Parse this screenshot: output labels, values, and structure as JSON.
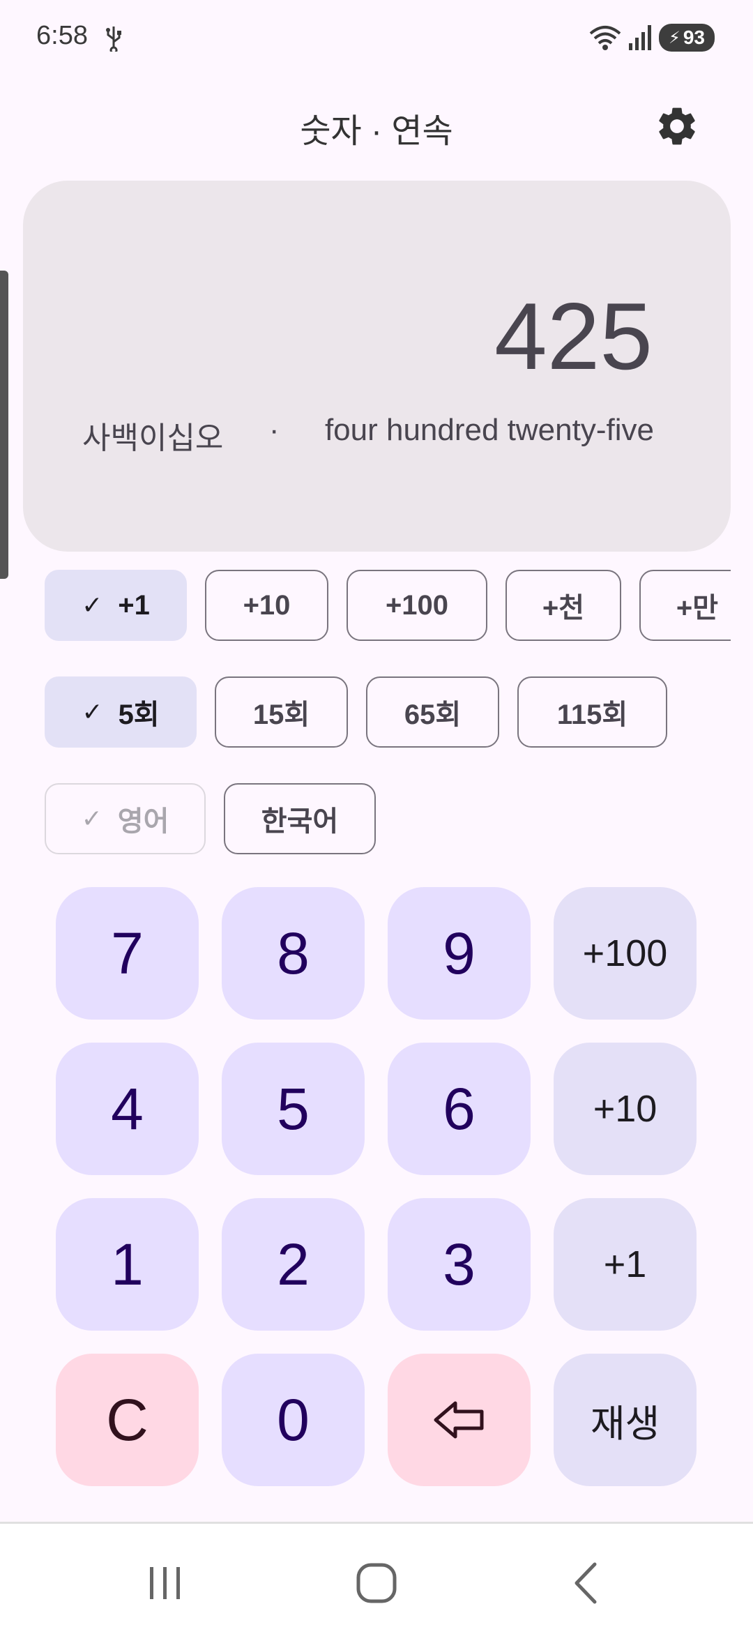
{
  "status_bar": {
    "time": "6:58",
    "battery": "93",
    "icons": [
      "usb-icon",
      "wifi-icon",
      "signal-icon",
      "battery-icon"
    ]
  },
  "header": {
    "title": "숫자 · 연속",
    "settings_icon": "gear-icon"
  },
  "display": {
    "number": "425",
    "korean": "사백이십오",
    "separator": "·",
    "english": "four hundred twenty-five"
  },
  "step_chips": [
    {
      "label": "+1",
      "selected": true
    },
    {
      "label": "+10",
      "selected": false
    },
    {
      "label": "+100",
      "selected": false
    },
    {
      "label": "+천",
      "selected": false
    },
    {
      "label": "+만",
      "selected": false
    }
  ],
  "count_chips": [
    {
      "label": "5회",
      "selected": true
    },
    {
      "label": "15회",
      "selected": false
    },
    {
      "label": "65회",
      "selected": false
    },
    {
      "label": "115회",
      "selected": false
    }
  ],
  "language_chips": [
    {
      "label": "영어",
      "selected": true,
      "disabled": true
    },
    {
      "label": "한국어",
      "selected": false
    }
  ],
  "keypad": {
    "k7": "7",
    "k8": "8",
    "k9": "9",
    "plus100": "+100",
    "k4": "4",
    "k5": "5",
    "k6": "6",
    "plus10": "+10",
    "k1": "1",
    "k2": "2",
    "k3": "3",
    "plus1": "+1",
    "clear": "C",
    "k0": "0",
    "backspace_icon": "backspace-arrow-icon",
    "play": "재생"
  },
  "colors": {
    "background": "#FEF7FF",
    "card": "#ECE6EB",
    "key": "#E6DEFF",
    "key_op": "#E4E0F7",
    "key_danger": "#FFD8E4",
    "chip_selected": "#E3E1F6"
  },
  "nav_bar": {
    "icons": [
      "recent-apps-icon",
      "home-icon",
      "back-icon"
    ]
  }
}
